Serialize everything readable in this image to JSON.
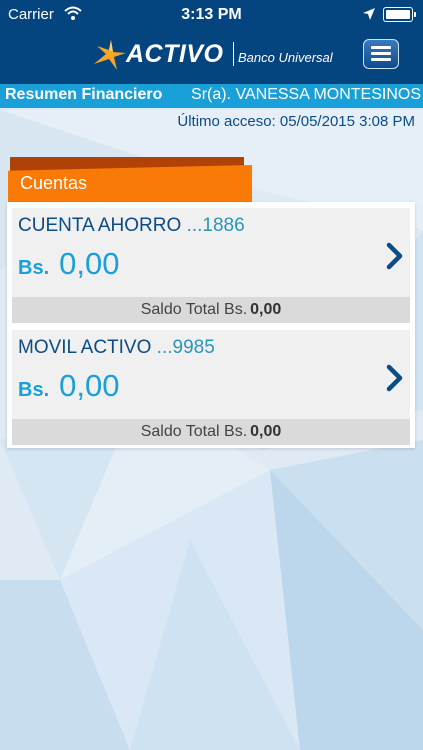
{
  "status_bar": {
    "carrier": "Carrier",
    "time": "3:13 PM"
  },
  "brand": {
    "name": "ACTIVO",
    "tagline": "Banco Universal"
  },
  "info_bar": {
    "section": "Resumen Financiero",
    "user": "Sr(a). VANESSA MONTESINOS"
  },
  "last_access": "Último acceso: 05/05/2015 3:08 PM",
  "accounts_tab": {
    "label": "Cuentas"
  },
  "accounts": [
    {
      "name": "CUENTA AHORRO",
      "number": "...1886",
      "currency": "Bs.",
      "amount": "0,00",
      "total_label": "Saldo Total Bs.",
      "total_value": "0,00"
    },
    {
      "name": "MOVIL ACTIVO",
      "number": "...9985",
      "currency": "Bs.",
      "amount": "0,00",
      "total_label": "Saldo Total Bs.",
      "total_value": "0,00"
    }
  ],
  "colors": {
    "header": "#05457f",
    "info_bar": "#1aa0d8",
    "tab": "#fa7a08",
    "tab_shadow": "#b14207",
    "amount": "#1aa0d8",
    "title": "#0b4b86"
  },
  "icons": [
    "wifi-icon",
    "location-icon",
    "battery-icon",
    "star-logo-icon",
    "menu-icon",
    "chevron-right-icon"
  ]
}
